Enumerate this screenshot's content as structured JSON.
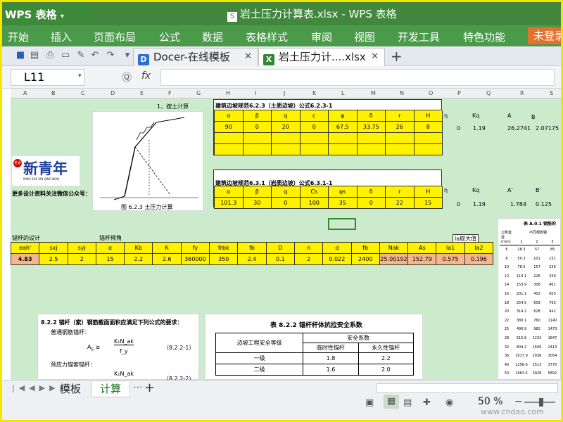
{
  "titlebar": {
    "app": "WPS 表格",
    "doc_title": "岩土压力计算表.xlsx - WPS 表格"
  },
  "menu": {
    "items": [
      "开始",
      "插入",
      "页面布局",
      "公式",
      "数据",
      "表格样式",
      "审阅",
      "视图",
      "开发工具",
      "特色功能"
    ],
    "login": "未登录"
  },
  "tabs": [
    {
      "label": "Docer-在线模板"
    },
    {
      "label": "岩土压力计....xlsx"
    }
  ],
  "formula": {
    "cell_ref": "L11",
    "fx": "fx"
  },
  "columns": [
    "A",
    "B",
    "C",
    "D",
    "E",
    "F",
    "G",
    "H",
    "I",
    "J",
    "K",
    "L",
    "M",
    "N",
    "O",
    "P",
    "Q",
    "R",
    "S"
  ],
  "sheet": {
    "heading1": "1、按土计算",
    "table1": {
      "title": "建筑边坡规范6.2.3（土质边坡）公式6.2.3-1",
      "headers": [
        "α",
        "β",
        "q",
        "c",
        "φ",
        "δ",
        "r",
        "H"
      ],
      "values": [
        "90",
        "0",
        "20",
        "0",
        "67.5",
        "33.75",
        "26",
        "8"
      ]
    },
    "eta": "η",
    "kq_label": "Kq",
    "a_label": "A",
    "b_label": "B",
    "row1_vals": {
      "eta": "0",
      "kq": "1.19",
      "a": "26.2741",
      "b": "2.07175"
    },
    "table2": {
      "title": "建筑边坡规范6.3.1（岩质边坡）公式6.3.1-1",
      "headers": [
        "α",
        "β",
        "q",
        "Cs",
        "φs",
        "δ",
        "r",
        "H"
      ],
      "values": [
        "101.3",
        "30",
        "0",
        "100",
        "35",
        "0",
        "22",
        "15"
      ]
    },
    "kq2_label": "Kq",
    "a2_label": "A'",
    "b2_label": "B'",
    "row2_vals": {
      "eta": "0",
      "kq": "1.19",
      "a": "1.784",
      "b": "0.125"
    },
    "figure_caption": "图 6.2.3 土压力计算",
    "logo_text": "新青年",
    "logo_sub": "MING SHE XIN QING NIAN",
    "logo_badge": "名设",
    "promo": "更多设计资料关注微信公众号：",
    "anchor_label": "锚杆的设计",
    "angle_label": "锚杆倾角",
    "la_label": "la取大值",
    "anchor_headers": [
      "eah'",
      "sxj",
      "syj",
      "α",
      "Kb",
      "K",
      "fy",
      "frbk",
      "fb",
      "D",
      "n",
      "d",
      "fb",
      "Nak",
      "As",
      "la1",
      "la2"
    ],
    "anchor_values": [
      "4.83",
      "2.5",
      "2",
      "15",
      "2.2",
      "2.6",
      "360000",
      "350",
      "2.4",
      "0.1",
      "2",
      "0.022",
      "2400",
      "25.00192",
      "152.79",
      "0.575",
      "0.196"
    ],
    "formula_section": {
      "title": "8.2.2 锚杆（索）钢筋截面面积应满足下列公式的要求：",
      "line1": "普通钢筋锚杆：",
      "eq1_lhs": "A",
      "eq1_num": "K₁N_ak",
      "eq1_den": "f_y",
      "eq1_no": "（8.2.2-1）",
      "line2": "预应力锚索锚杆：",
      "eq2_num": "K₁N_ak",
      "eq2_no": "（8.2.2-2）"
    },
    "safety_table": {
      "title": "表 8.2.2 锚杆杆体抗拉安全系数",
      "col1": "边坡工程安全等级",
      "col_group": "安全系数",
      "col2": "临时性锚杆",
      "col3": "永久性锚杆",
      "rows": [
        [
          "一级",
          "1.8",
          "2.2"
        ],
        [
          "二级",
          "1.6",
          "2.0"
        ]
      ]
    },
    "side_table": {
      "title": "表 A.0.1 钢筋的",
      "col_head1": "公称直径(mm)",
      "col_head2": "不同根数钢",
      "nums": [
        "1",
        "2",
        "3"
      ],
      "rows": [
        [
          "6",
          "28.3",
          "57",
          "85"
        ],
        [
          "8",
          "50.3",
          "101",
          "151"
        ],
        [
          "10",
          "78.5",
          "157",
          "236"
        ],
        [
          "12",
          "113.1",
          "226",
          "339"
        ],
        [
          "14",
          "153.9",
          "308",
          "461"
        ],
        [
          "16",
          "201.1",
          "402",
          "603"
        ],
        [
          "18",
          "254.5",
          "509",
          "763"
        ],
        [
          "20",
          "314.2",
          "628",
          "942"
        ],
        [
          "22",
          "380.1",
          "760",
          "1140"
        ],
        [
          "25",
          "490.9",
          "982",
          "1473"
        ],
        [
          "28",
          "615.8",
          "1232",
          "1847"
        ],
        [
          "32",
          "804.2",
          "1609",
          "2413"
        ],
        [
          "36",
          "1017.9",
          "2036",
          "3054"
        ],
        [
          "40",
          "1256.6",
          "2513",
          "3770"
        ],
        [
          "50",
          "1963.5",
          "3928",
          "5892"
        ]
      ]
    }
  },
  "status": {
    "sheets": [
      "模板",
      "计算"
    ],
    "active_sheet": "计算",
    "zoom": "50 %",
    "watermark": "www.cndao.com"
  }
}
